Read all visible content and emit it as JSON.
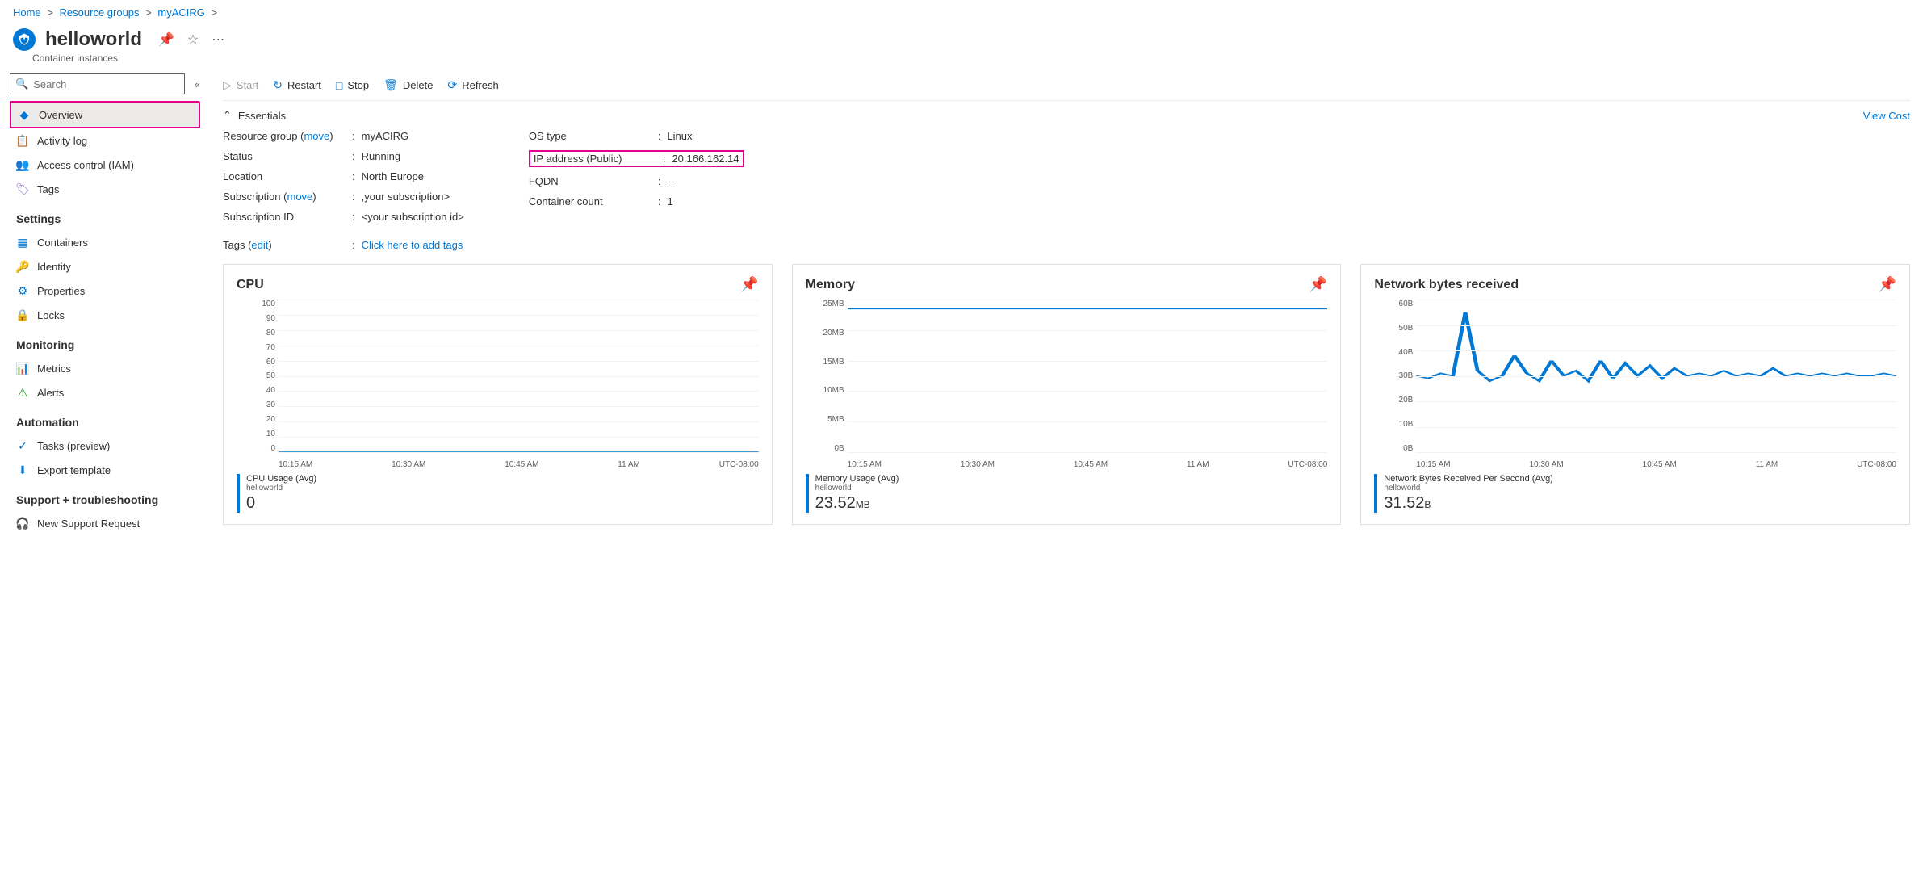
{
  "breadcrumb": {
    "home": "Home",
    "rg": "Resource groups",
    "group": "myACIRG"
  },
  "header": {
    "title": "helloworld",
    "subtitle": "Container instances"
  },
  "search": {
    "placeholder": "Search"
  },
  "nav": {
    "overview": "Overview",
    "activity": "Activity log",
    "iam": "Access control (IAM)",
    "tags": "Tags",
    "settings_h": "Settings",
    "containers": "Containers",
    "identity": "Identity",
    "properties": "Properties",
    "locks": "Locks",
    "monitoring_h": "Monitoring",
    "metrics": "Metrics",
    "alerts": "Alerts",
    "automation_h": "Automation",
    "tasks": "Tasks (preview)",
    "export": "Export template",
    "support_h": "Support + troubleshooting",
    "support": "New Support Request"
  },
  "toolbar": {
    "start": "Start",
    "restart": "Restart",
    "stop": "Stop",
    "delete": "Delete",
    "refresh": "Refresh"
  },
  "essentials": {
    "heading": "Essentials",
    "view_cost": "View Cost",
    "left": {
      "rg_label": "Resource group (",
      "rg_move": "move",
      "rg_label2": ")",
      "rg_value": "myACIRG",
      "status_label": "Status",
      "status_value": "Running",
      "location_label": "Location",
      "location_value": "North Europe",
      "sub_label": "Subscription (",
      "sub_move": "move",
      "sub_label2": ")",
      "sub_value": ",your subscription>",
      "subid_label": "Subscription ID",
      "subid_value": "<your subscription id>"
    },
    "right": {
      "os_label": "OS type",
      "os_value": "Linux",
      "ip_label": "IP address (Public)",
      "ip_value": "20.166.162.14",
      "fqdn_label": "FQDN",
      "fqdn_value": "---",
      "count_label": "Container count",
      "count_value": "1"
    },
    "tags_label": "Tags (",
    "tags_edit": "edit",
    "tags_label2": ")",
    "tags_value": "Click here to add tags"
  },
  "charts": {
    "x_ticks": [
      "10:15 AM",
      "10:30 AM",
      "10:45 AM",
      "11 AM",
      "UTC-08:00"
    ],
    "cpu": {
      "title": "CPU",
      "legend": "CPU Usage (Avg)",
      "sub": "helloworld",
      "value": "0",
      "unit": ""
    },
    "mem": {
      "title": "Memory",
      "legend": "Memory Usage (Avg)",
      "sub": "helloworld",
      "value": "23.52",
      "unit": "MB"
    },
    "net": {
      "title": "Network bytes received",
      "legend": "Network Bytes Received Per Second (Avg)",
      "sub": "helloworld",
      "value": "31.52",
      "unit": "B"
    }
  },
  "chart_data": [
    {
      "type": "line",
      "title": "CPU",
      "ylabel": "",
      "ylim": [
        0,
        100
      ],
      "y_ticks": [
        100,
        90,
        80,
        70,
        60,
        50,
        40,
        30,
        20,
        10,
        0
      ],
      "x": [
        "10:15 AM",
        "10:30 AM",
        "10:45 AM",
        "11 AM"
      ],
      "series": [
        {
          "name": "CPU Usage (Avg) helloworld",
          "values": [
            0,
            0,
            0,
            0
          ]
        }
      ]
    },
    {
      "type": "line",
      "title": "Memory",
      "ylabel": "",
      "ylim": [
        0,
        25
      ],
      "y_ticks": [
        "25MB",
        "20MB",
        "15MB",
        "10MB",
        "5MB",
        "0B"
      ],
      "x": [
        "10:15 AM",
        "10:30 AM",
        "10:45 AM",
        "11 AM"
      ],
      "series": [
        {
          "name": "Memory Usage (Avg) helloworld",
          "values": [
            23.5,
            23.5,
            23.5,
            23.5
          ]
        }
      ]
    },
    {
      "type": "line",
      "title": "Network bytes received",
      "ylabel": "",
      "ylim": [
        0,
        60
      ],
      "y_ticks": [
        "60B",
        "50B",
        "40B",
        "30B",
        "20B",
        "10B",
        "0B"
      ],
      "x": [
        "10:15 AM",
        "10:30 AM",
        "10:45 AM",
        "11 AM"
      ],
      "series": [
        {
          "name": "Network Bytes Received Per Second (Avg) helloworld",
          "values": [
            30,
            29,
            31,
            30,
            55,
            32,
            28,
            30,
            38,
            31,
            28,
            36,
            30,
            32,
            28,
            36,
            29,
            35,
            30,
            34,
            29,
            33,
            30,
            31,
            30,
            32,
            30,
            31,
            30,
            33,
            30,
            31,
            30,
            31,
            30,
            31,
            30,
            30,
            31,
            30
          ]
        }
      ]
    }
  ]
}
